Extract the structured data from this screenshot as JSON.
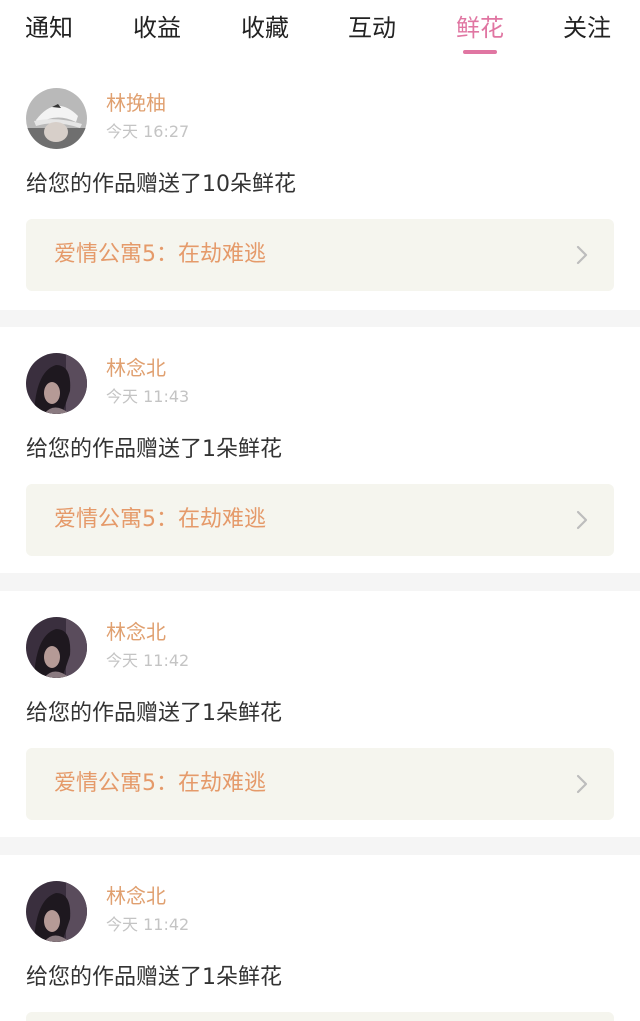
{
  "tabs": [
    {
      "label": "通知"
    },
    {
      "label": "收益"
    },
    {
      "label": "收藏"
    },
    {
      "label": "互动"
    },
    {
      "label": "鲜花",
      "active": true
    },
    {
      "label": "关注"
    }
  ],
  "feed": [
    {
      "user": "林挽柚",
      "time": "今天 16:27",
      "message": "给您的作品赠送了10朵鲜花",
      "work_title": "爱情公寓5：在劫难逃",
      "avatar_icon": "avatar-cap-girl-icon"
    },
    {
      "user": "林念北",
      "time": "今天 11:43",
      "message": "给您的作品赠送了1朵鲜花",
      "work_title": "爱情公寓5：在劫难逃",
      "avatar_icon": "avatar-dark-girl-icon"
    },
    {
      "user": "林念北",
      "time": "今天 11:42",
      "message": "给您的作品赠送了1朵鲜花",
      "work_title": "爱情公寓5：在劫难逃",
      "avatar_icon": "avatar-dark-girl-icon"
    },
    {
      "user": "林念北",
      "time": "今天 11:42",
      "message": "给您的作品赠送了1朵鲜花",
      "work_title": "",
      "avatar_icon": "avatar-dark-girl-icon"
    }
  ],
  "colors": {
    "accent": "#e076a2",
    "username": "#e0a070",
    "work_title": "#e59a6a",
    "work_card_bg": "#f5f5ee",
    "separator": "#f5f5f5"
  }
}
